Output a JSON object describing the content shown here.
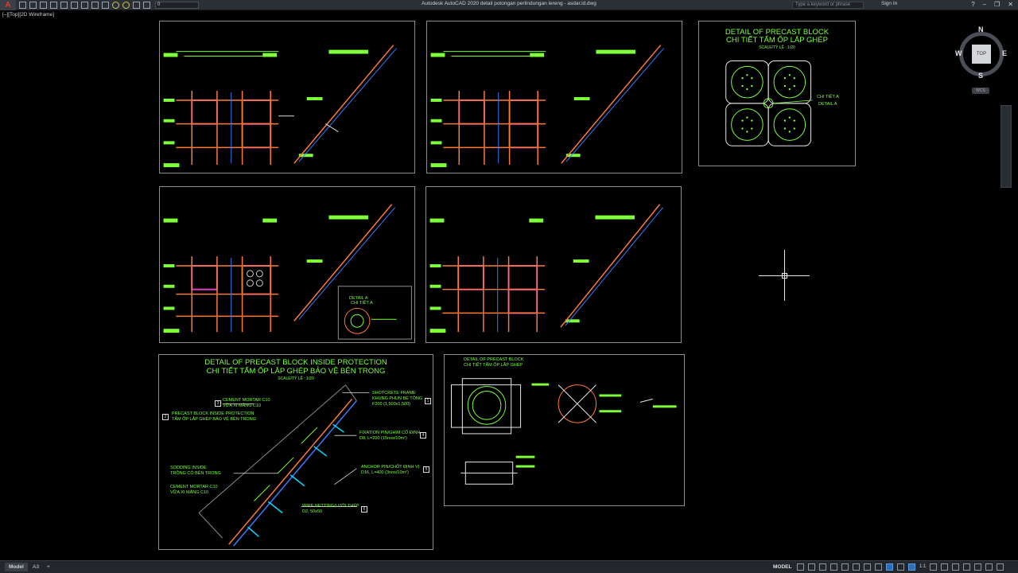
{
  "titlebar": {
    "app_button": "A",
    "layer_value": "0",
    "title": "Autodesk AutoCAD 2020    detail potongan perlindungan lereng - asdar.id.dwg",
    "search_placeholder": "Type a keyword or phrase",
    "signin": "Sign In",
    "help": "?"
  },
  "viewport": {
    "label": "[–][Top][2D Wireframe]"
  },
  "viewcube": {
    "face": "TOP",
    "north": "N",
    "south": "S",
    "east": "E",
    "west": "W",
    "wcs": "WCS"
  },
  "panels": {
    "precast_block": {
      "title1": "DETAIL OF PRECAST BLOCK",
      "title2": "CHI TIẾT TẤM ỐP LẮP GHÉP",
      "scale": "SCALE/TỶ LỆ : 1/20",
      "note1": "CHI TIẾT A",
      "note2": "DETAIL A"
    },
    "detail_a": {
      "title": "DETAIL A",
      "subtitle": "CHI TIẾT A"
    },
    "inside": {
      "title1": "DETAIL OF PRECAST BLOCK INSIDE PROTECTION",
      "title2": "CHI TIẾT TẤM ỐP LẮP GHÉP BẢO VỆ BÊN TRONG",
      "scale": "SCALE/TỶ LỆ : 1/20",
      "notes": [
        "CEMENT MORTAR C10\nVỮA XI MĂNG C10",
        "PRECAST BLOCK INSIDE PROTECTION\nTẤM ỐP LẮP GHÉP BẢO VỆ BÊN TRONG",
        "SODDING INSIDE\nTRỒNG CỎ BÊN TRONG",
        "CEMENT MORTAR C10\nVỮA XI MĂNG C10",
        "SHOTCRETE FRAME\nKHUNG PHUN BÊ TÔNG",
        "F200 (1,500x1,500)",
        "FIXATION PIN/GHIM CỐ ĐỊNH\nD8, L=200 (15nos/10m²)",
        "ANCHOR PIN/CHỐT ĐỊNH VỊ\nD16, L=400 (3nos/10m²)",
        "WIRE NETTING/LƯỚI THÉP\nD2, 50x50"
      ],
      "nums": [
        "3",
        "2",
        "1",
        "4",
        "5",
        "6"
      ]
    },
    "small_detail": {
      "title": "DETAIL OF PRECAST BLOCK\nCHI TIẾT TẤM ỐP LẮP GHÉP"
    }
  },
  "statusbar": {
    "tabs": [
      "Model",
      "A3",
      "+"
    ],
    "model_label": "MODEL",
    "scale": "1:1"
  }
}
